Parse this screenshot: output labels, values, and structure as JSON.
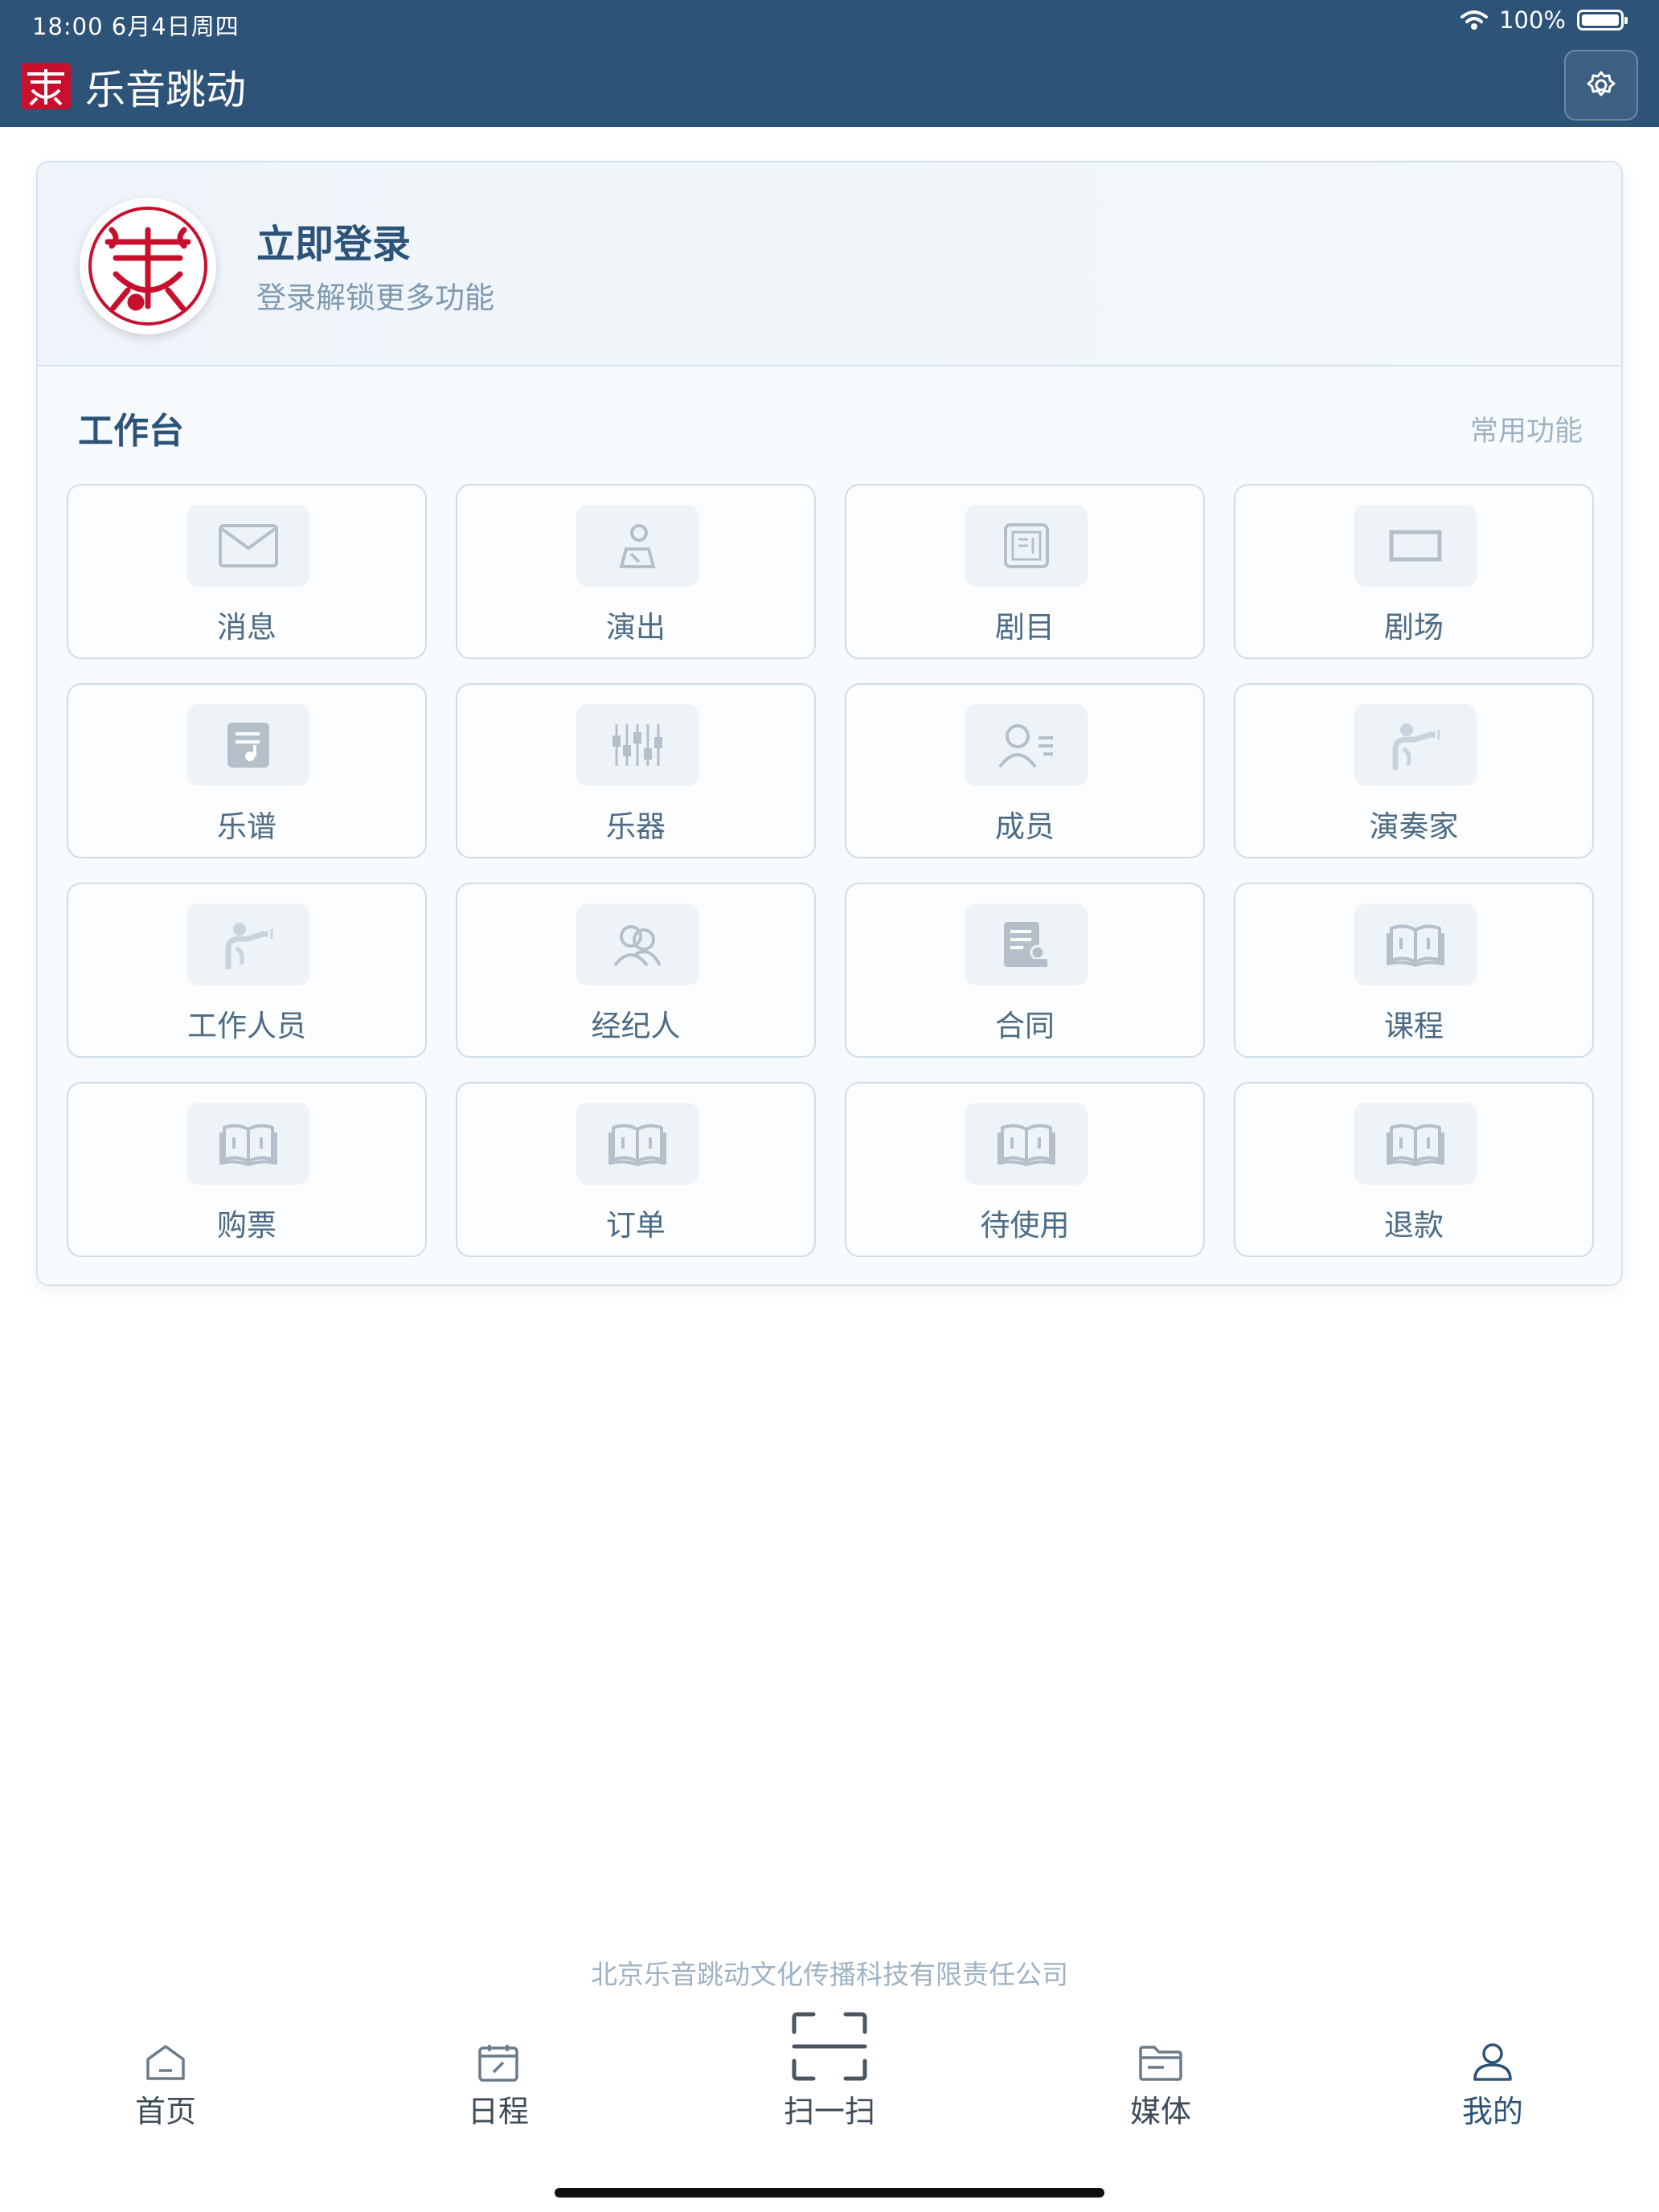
{
  "status_bar": {
    "time": "18:00  6月4日周四",
    "wifi_icon": "wifi-icon",
    "battery": "100%"
  },
  "header": {
    "title": "乐音跳动",
    "settings_icon": "gear-icon"
  },
  "profile": {
    "title": "立即登录",
    "subtitle": "登录解锁更多功能"
  },
  "workspace": {
    "title": "工作台",
    "link": "常用功能",
    "tiles": [
      {
        "label": "消息",
        "icon": "envelope-icon"
      },
      {
        "label": "演出",
        "icon": "performer-icon"
      },
      {
        "label": "剧目",
        "icon": "repertoire-icon"
      },
      {
        "label": "剧场",
        "icon": "theater-icon"
      },
      {
        "label": "乐谱",
        "icon": "sheet-music-icon"
      },
      {
        "label": "乐器",
        "icon": "mixer-icon"
      },
      {
        "label": "成员",
        "icon": "member-icon"
      },
      {
        "label": "演奏家",
        "icon": "musician-icon"
      },
      {
        "label": "工作人员",
        "icon": "staff-icon"
      },
      {
        "label": "经纪人",
        "icon": "agent-icon"
      },
      {
        "label": "合同",
        "icon": "contract-icon"
      },
      {
        "label": "课程",
        "icon": "book-icon"
      },
      {
        "label": "购票",
        "icon": "book-icon"
      },
      {
        "label": "订单",
        "icon": "book-icon"
      },
      {
        "label": "待使用",
        "icon": "book-icon"
      },
      {
        "label": "退款",
        "icon": "book-icon"
      }
    ]
  },
  "footer": {
    "company": "北京乐音跳动文化传播科技有限责任公司"
  },
  "tabbar": {
    "items": [
      {
        "label": "首页",
        "icon": "home-icon"
      },
      {
        "label": "日程",
        "icon": "calendar-icon"
      },
      {
        "label": "扫一扫",
        "icon": "scan-icon"
      },
      {
        "label": "媒体",
        "icon": "folder-icon"
      },
      {
        "label": "我的",
        "icon": "user-icon",
        "active": true
      }
    ]
  },
  "colors": {
    "primary": "#2d5378",
    "logo_red": "#c8102e",
    "tile_border": "#cddde9"
  }
}
